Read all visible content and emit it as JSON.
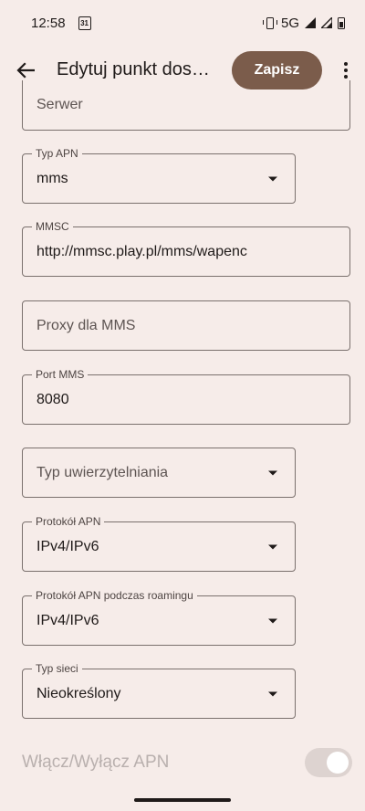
{
  "status_bar": {
    "time": "12:58",
    "calendar_day": "31",
    "network": "5G"
  },
  "app_bar": {
    "title": "Edytuj punkt dos…",
    "save_label": "Zapisz",
    "back_icon": "arrow-back-icon",
    "more_icon": "more-vert-icon"
  },
  "fields": {
    "server": {
      "value": "Serwer",
      "is_placeholder": true
    },
    "apn_type": {
      "label": "Typ APN",
      "value": "mms"
    },
    "mmsc": {
      "label": "MMSC",
      "value": "http://mmsc.play.pl/mms/wapenc"
    },
    "mms_proxy": {
      "value": "Proxy dla MMS",
      "is_placeholder": true
    },
    "mms_port": {
      "label": "Port MMS",
      "value": "8080"
    },
    "auth_type": {
      "value": "Typ uwierzytelniania",
      "is_placeholder": true
    },
    "apn_protocol": {
      "label": "Protokół APN",
      "value": "IPv4/IPv6"
    },
    "apn_roaming_protocol": {
      "label": "Protokół APN podczas roamingu",
      "value": "IPv4/IPv6"
    },
    "network_type": {
      "label": "Typ sieci",
      "value": "Nieokreślony"
    }
  },
  "toggle": {
    "label": "Włącz/Wyłącz APN",
    "enabled": true,
    "disabled_appearance": true
  },
  "colors": {
    "background": "#f6ece9",
    "accent": "#7b5c4b",
    "outline": "#7a706d"
  }
}
